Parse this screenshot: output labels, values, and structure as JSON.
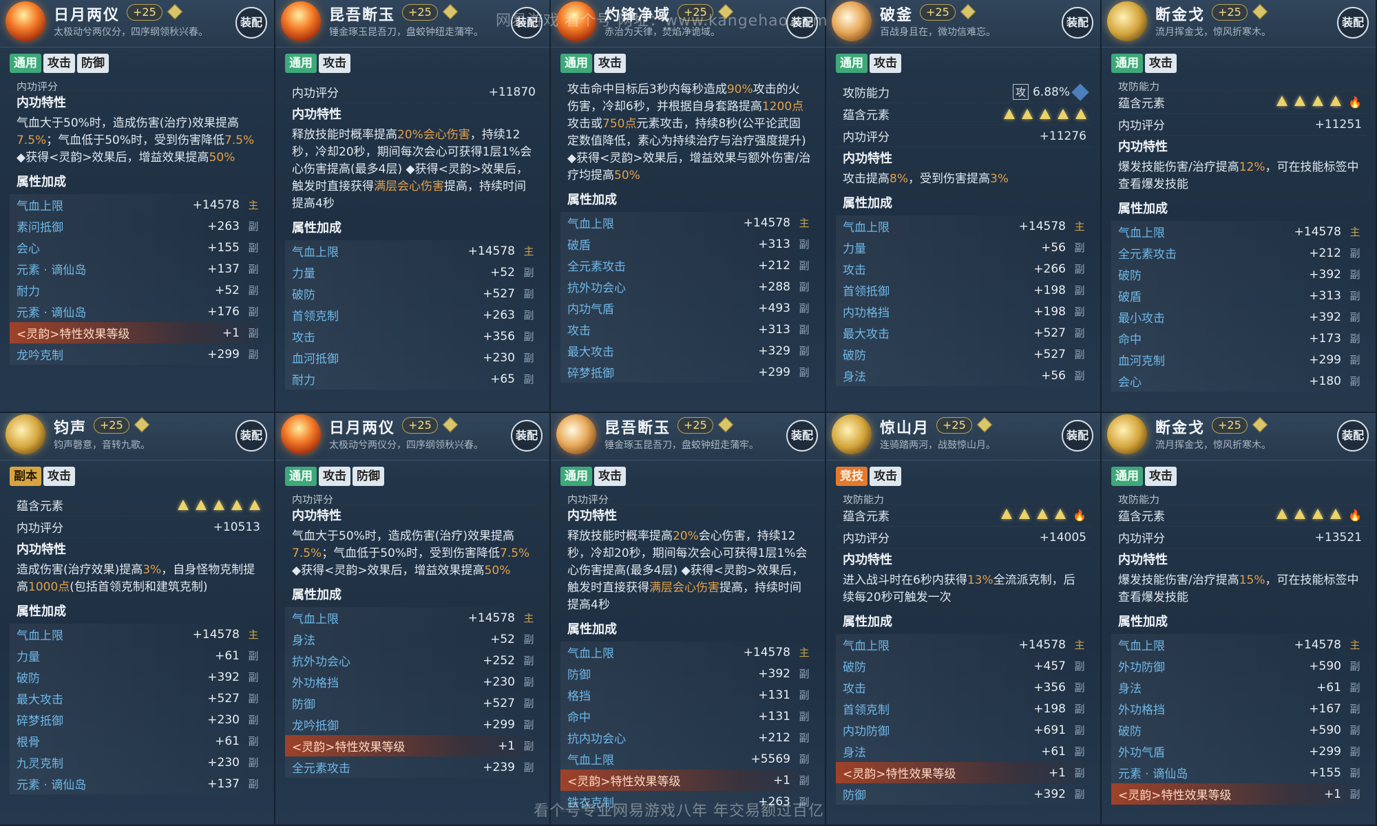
{
  "watermark_top": "网易游戏 看个号   网址：www.kangehao.com",
  "watermark_bottom": "看个号专业网易游戏八年  年交易额过百亿",
  "cards": [
    {
      "name": "日月两仪",
      "level": "+25",
      "desc": "太极动兮两仪分，四序纲领秋兴春。",
      "equip": "装配",
      "tabs": [
        "通用",
        "攻击",
        "防御"
      ],
      "partial_top": "内功评分",
      "section_trait": "内功特性",
      "trait_parts": [
        {
          "t": "气血大于50%时，造成伤害(治疗)效果提高"
        },
        {
          "t": "7.5%",
          "hl": true
        },
        {
          "t": "；气血低于50%时，受到伤害降低"
        },
        {
          "t": "7.5%",
          "hl": true
        },
        {
          "t": " ◆获得<灵韵>效果后，增益效果提高"
        },
        {
          "t": "50%",
          "hl": true
        }
      ],
      "section_attr": "属性加成",
      "stats": [
        {
          "name": "气血上限",
          "value": "+14578",
          "icon": "主"
        },
        {
          "name": "素问抵御",
          "value": "+263",
          "icon": "副"
        },
        {
          "name": "会心",
          "value": "+155",
          "icon": "副"
        },
        {
          "name": "元素 · 谪仙岛",
          "value": "+137",
          "icon": "副"
        },
        {
          "name": "耐力",
          "value": "+52",
          "icon": "副"
        },
        {
          "name": "元素 · 谪仙岛",
          "value": "+176",
          "icon": "副"
        },
        {
          "name": "<灵韵>特性效果等级",
          "value": "+1",
          "icon": "副",
          "linyun": true
        },
        {
          "name": "龙吟克制",
          "value": "+299",
          "icon": "副"
        }
      ]
    },
    {
      "name": "昆吾断玉",
      "level": "+25",
      "desc": "锤金琢玉昆吾刀，盘蛟钟纽走蒲牢。",
      "equip": "装配",
      "tabs": [
        "通用",
        "攻击"
      ],
      "score_label": "内功评分",
      "score": "+11870",
      "section_trait": "内功特性",
      "trait_parts": [
        {
          "t": "释放技能时概率提高"
        },
        {
          "t": "20%会心伤害",
          "hl": true
        },
        {
          "t": "，持续12秒，冷却20秒，期间每次会心可获得1层1%会心伤害提高(最多4层)"
        },
        {
          "t": " ◆获得<灵韵>效果后，触发时直接获得"
        },
        {
          "t": "满层会心伤害",
          "hl": true
        },
        {
          "t": "提高，持续时间提高4秒"
        }
      ],
      "section_attr": "属性加成",
      "stats": [
        {
          "name": "气血上限",
          "value": "+14578",
          "icon": "主"
        },
        {
          "name": "力量",
          "value": "+52",
          "icon": "副"
        },
        {
          "name": "破防",
          "value": "+527",
          "icon": "副"
        },
        {
          "name": "首领克制",
          "value": "+263",
          "icon": "副"
        },
        {
          "name": "攻击",
          "value": "+356",
          "icon": "副"
        },
        {
          "name": "血河抵御",
          "value": "+230",
          "icon": "副"
        },
        {
          "name": "耐力",
          "value": "+65",
          "icon": "副"
        }
      ]
    },
    {
      "name": "灼锋净域",
      "level": "+25",
      "desc": "赤治为天律，焚焰净诡域。",
      "equip": "装配",
      "tabs": [
        "通用",
        "攻击"
      ],
      "trait_parts": [
        {
          "t": "攻击命中目标后3秒内每秒造成"
        },
        {
          "t": "90%",
          "hl": true
        },
        {
          "t": "攻击的火伤害，冷却6秒，并根据自身套路提高"
        },
        {
          "t": "1200点",
          "hl": true
        },
        {
          "t": "攻击或"
        },
        {
          "t": "750点",
          "hl": true
        },
        {
          "t": "元素攻击，持续8秒(公平论武固定数值降低，素心为持续治疗与治疗强度提升)"
        },
        {
          "t": " ◆获得<灵韵>效果后，增益效果与额外伤害/治疗均提高"
        },
        {
          "t": "50%",
          "hl": true
        }
      ],
      "section_attr": "属性加成",
      "stats": [
        {
          "name": "气血上限",
          "value": "+14578",
          "icon": "主"
        },
        {
          "name": "破盾",
          "value": "+313",
          "icon": "副"
        },
        {
          "name": "全元素攻击",
          "value": "+212",
          "icon": "副"
        },
        {
          "name": "抗外功会心",
          "value": "+288",
          "icon": "副"
        },
        {
          "name": "内功气盾",
          "value": "+493",
          "icon": "副"
        },
        {
          "name": "攻击",
          "value": "+313",
          "icon": "副"
        },
        {
          "name": "最大攻击",
          "value": "+329",
          "icon": "副"
        },
        {
          "name": "碎梦抵御",
          "value": "+299",
          "icon": "副"
        }
      ]
    },
    {
      "name": "破釜",
      "level": "+25",
      "desc": "百战身且在，微功信难忘。",
      "equip": "装配",
      "tabs": [
        "通用",
        "攻击"
      ],
      "atk_label": "攻防能力",
      "atk_box": "攻",
      "atk_val": "6.88%",
      "element_label": "蕴含元素",
      "element_tris": 5,
      "element_flame": false,
      "score_label": "内功评分",
      "score": "+11276",
      "section_trait": "内功特性",
      "trait_parts": [
        {
          "t": "攻击提高"
        },
        {
          "t": "8%",
          "hl": true
        },
        {
          "t": "，受到伤害提高"
        },
        {
          "t": "3%",
          "hl": true
        }
      ],
      "section_attr": "属性加成",
      "stats": [
        {
          "name": "气血上限",
          "value": "+14578",
          "icon": "主"
        },
        {
          "name": "力量",
          "value": "+56",
          "icon": "副"
        },
        {
          "name": "攻击",
          "value": "+266",
          "icon": "副"
        },
        {
          "name": "首领抵御",
          "value": "+198",
          "icon": "副"
        },
        {
          "name": "内功格挡",
          "value": "+198",
          "icon": "副"
        },
        {
          "name": "最大攻击",
          "value": "+527",
          "icon": "副"
        },
        {
          "name": "破防",
          "value": "+527",
          "icon": "副"
        },
        {
          "name": "身法",
          "value": "+56",
          "icon": "副"
        }
      ]
    },
    {
      "name": "断金戈",
      "level": "+25",
      "desc": "流月挥金戈，惊风折寒木。",
      "equip": "装配",
      "tabs": [
        "通用",
        "攻击"
      ],
      "partial_top": "攻防能力",
      "element_label": "蕴含元素",
      "element_tris": 4,
      "element_flame": true,
      "score_label": "内功评分",
      "score": "+11251",
      "section_trait": "内功特性",
      "trait_parts": [
        {
          "t": "爆发技能伤害/治疗提高"
        },
        {
          "t": "12%",
          "hl": true
        },
        {
          "t": "，可在技能标签中查看爆发技能"
        }
      ],
      "section_attr": "属性加成",
      "stats": [
        {
          "name": "气血上限",
          "value": "+14578",
          "icon": "主"
        },
        {
          "name": "全元素攻击",
          "value": "+212",
          "icon": "副"
        },
        {
          "name": "破防",
          "value": "+392",
          "icon": "副"
        },
        {
          "name": "破盾",
          "value": "+313",
          "icon": "副"
        },
        {
          "name": "最小攻击",
          "value": "+392",
          "icon": "副"
        },
        {
          "name": "命中",
          "value": "+173",
          "icon": "副"
        },
        {
          "name": "血河克制",
          "value": "+299",
          "icon": "副"
        },
        {
          "name": "会心",
          "value": "+180",
          "icon": "副"
        }
      ]
    },
    {
      "name": "钧声",
      "level": "+25",
      "desc": "钧声磬意，音转九歌。",
      "equip": "装配",
      "tabs": [
        "副本",
        "攻击"
      ],
      "element_label": "蕴含元素",
      "element_tris": 5,
      "element_flame": false,
      "score_label": "内功评分",
      "score": "+10513",
      "section_trait": "内功特性",
      "trait_parts": [
        {
          "t": "造成伤害(治疗效果)提高"
        },
        {
          "t": "3%",
          "hl": true
        },
        {
          "t": "，自身怪物克制提高"
        },
        {
          "t": "1000点",
          "hl": true
        },
        {
          "t": "(包括首领克制和建筑克制)"
        }
      ],
      "section_attr": "属性加成",
      "stats": [
        {
          "name": "气血上限",
          "value": "+14578",
          "icon": "主"
        },
        {
          "name": "力量",
          "value": "+61",
          "icon": "副"
        },
        {
          "name": "破防",
          "value": "+392",
          "icon": "副"
        },
        {
          "name": "最大攻击",
          "value": "+527",
          "icon": "副"
        },
        {
          "name": "碎梦抵御",
          "value": "+230",
          "icon": "副"
        },
        {
          "name": "根骨",
          "value": "+61",
          "icon": "副"
        },
        {
          "name": "九灵克制",
          "value": "+230",
          "icon": "副"
        },
        {
          "name": "元素 · 谪仙岛",
          "value": "+137",
          "icon": "副"
        }
      ]
    },
    {
      "name": "日月两仪",
      "level": "+25",
      "desc": "太极动兮两仪分，四序纲领秋兴春。",
      "equip": "装配",
      "tabs": [
        "通用",
        "攻击",
        "防御"
      ],
      "partial_top": "内功评分",
      "section_trait": "内功特性",
      "trait_parts": [
        {
          "t": "气血大于50%时，造成伤害(治疗)效果提高"
        },
        {
          "t": "7.5%",
          "hl": true
        },
        {
          "t": "；气血低于50%时，受到伤害降低"
        },
        {
          "t": "7.5%",
          "hl": true
        },
        {
          "t": " ◆获得<灵韵>效果后，增益效果提高"
        },
        {
          "t": "50%",
          "hl": true
        }
      ],
      "section_attr": "属性加成",
      "stats": [
        {
          "name": "气血上限",
          "value": "+14578",
          "icon": "主"
        },
        {
          "name": "身法",
          "value": "+52",
          "icon": "副"
        },
        {
          "name": "抗外功会心",
          "value": "+252",
          "icon": "副"
        },
        {
          "name": "外功格挡",
          "value": "+230",
          "icon": "副"
        },
        {
          "name": "防御",
          "value": "+527",
          "icon": "副"
        },
        {
          "name": "龙吟抵御",
          "value": "+299",
          "icon": "副"
        },
        {
          "name": "<灵韵>特性效果等级",
          "value": "+1",
          "icon": "副",
          "linyun": true
        },
        {
          "name": "全元素攻击",
          "value": "+239",
          "icon": "副"
        }
      ]
    },
    {
      "name": "昆吾断玉",
      "level": "+25",
      "desc": "锤金琢玉昆吾刀，盘蛟钟纽走蒲牢。",
      "equip": "装配",
      "tabs": [
        "通用",
        "攻击"
      ],
      "partial_top": "内功评分",
      "section_trait": "内功特性",
      "trait_parts": [
        {
          "t": "释放技能时概率提高"
        },
        {
          "t": "20%",
          "hl": true
        },
        {
          "t": "会心伤害，持续12秒，冷却20秒，期间每次会心可获得1层1%会心伤害提高(最多4层)"
        },
        {
          "t": " ◆获得<灵韵>效果后，触发时直接获得"
        },
        {
          "t": "满层会心伤害",
          "hl": true
        },
        {
          "t": "提高，持续时间提高4秒"
        }
      ],
      "section_attr": "属性加成",
      "stats": [
        {
          "name": "气血上限",
          "value": "+14578",
          "icon": "主"
        },
        {
          "name": "防御",
          "value": "+392",
          "icon": "副"
        },
        {
          "name": "格挡",
          "value": "+131",
          "icon": "副"
        },
        {
          "name": "命中",
          "value": "+131",
          "icon": "副"
        },
        {
          "name": "抗内功会心",
          "value": "+212",
          "icon": "副"
        },
        {
          "name": "气血上限",
          "value": "+5569",
          "icon": "副"
        },
        {
          "name": "<灵韵>特性效果等级",
          "value": "+1",
          "icon": "副",
          "linyun": true
        },
        {
          "name": "铁衣克制",
          "value": "+263",
          "icon": "副"
        }
      ]
    },
    {
      "name": "惊山月",
      "level": "+25",
      "desc": "连骑踏两河，战鼓惊山月。",
      "equip": "装配",
      "tabs": [
        "竞技",
        "攻击"
      ],
      "partial_top": "攻防能力",
      "element_label": "蕴含元素",
      "element_tris": 4,
      "element_flame": true,
      "score_label": "内功评分",
      "score": "+14005",
      "section_trait": "内功特性",
      "trait_parts": [
        {
          "t": "进入战斗时在6秒内获得"
        },
        {
          "t": "13%",
          "hl": true
        },
        {
          "t": "全流派克制，后续每20秒可触发一次"
        }
      ],
      "section_attr": "属性加成",
      "stats": [
        {
          "name": "气血上限",
          "value": "+14578",
          "icon": "主"
        },
        {
          "name": "破防",
          "value": "+457",
          "icon": "副"
        },
        {
          "name": "攻击",
          "value": "+356",
          "icon": "副"
        },
        {
          "name": "首领克制",
          "value": "+198",
          "icon": "副"
        },
        {
          "name": "内功防御",
          "value": "+691",
          "icon": "副"
        },
        {
          "name": "身法",
          "value": "+61",
          "icon": "副"
        },
        {
          "name": "<灵韵>特性效果等级",
          "value": "+1",
          "icon": "副",
          "linyun": true
        },
        {
          "name": "防御",
          "value": "+392",
          "icon": "副"
        }
      ]
    },
    {
      "name": "断金戈",
      "level": "+25",
      "desc": "流月挥金戈，惊风折寒木。",
      "equip": "装配",
      "tabs": [
        "通用",
        "攻击"
      ],
      "partial_top": "攻防能力",
      "element_label": "蕴含元素",
      "element_tris": 4,
      "element_flame": true,
      "score_label": "内功评分",
      "score": "+13521",
      "section_trait": "内功特性",
      "trait_parts": [
        {
          "t": "爆发技能伤害/治疗提高"
        },
        {
          "t": "15%",
          "hl": true
        },
        {
          "t": "，可在技能标签中查看爆发技能"
        }
      ],
      "section_attr": "属性加成",
      "stats": [
        {
          "name": "气血上限",
          "value": "+14578",
          "icon": "主"
        },
        {
          "name": "外功防御",
          "value": "+590",
          "icon": "副"
        },
        {
          "name": "身法",
          "value": "+61",
          "icon": "副"
        },
        {
          "name": "外功格挡",
          "value": "+167",
          "icon": "副"
        },
        {
          "name": "破防",
          "value": "+590",
          "icon": "副"
        },
        {
          "name": "外功气盾",
          "value": "+299",
          "icon": "副"
        },
        {
          "name": "元素 · 谪仙岛",
          "value": "+155",
          "icon": "副"
        },
        {
          "name": "<灵韵>特性效果等级",
          "value": "+1",
          "icon": "副",
          "linyun": true
        }
      ]
    }
  ]
}
